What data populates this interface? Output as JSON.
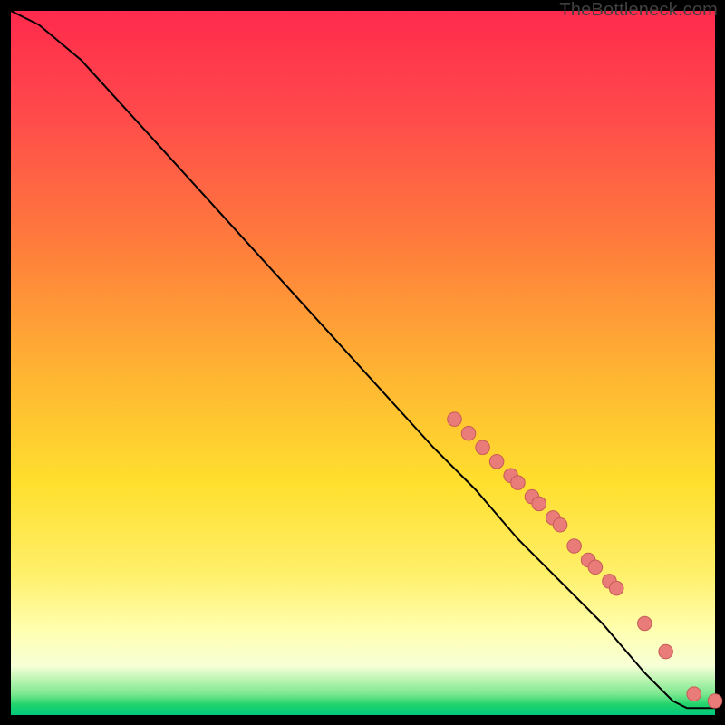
{
  "attribution": "TheBottleneck.com",
  "colors": {
    "dot_fill": "#e97c78",
    "dot_stroke": "#c65b57",
    "curve": "#000000",
    "bg": "#000000"
  },
  "chart_data": {
    "type": "line",
    "title": "",
    "xlabel": "",
    "ylabel": "",
    "xlim": [
      0,
      100
    ],
    "ylim": [
      0,
      100
    ],
    "grid": false,
    "background_gradient": [
      {
        "pos": 0,
        "color": "#ff2a4d"
      },
      {
        "pos": 33,
        "color": "#ff7c3c"
      },
      {
        "pos": 67,
        "color": "#ffdf2e"
      },
      {
        "pos": 90,
        "color": "#ffffb0"
      },
      {
        "pos": 100,
        "color": "#00c97a"
      }
    ],
    "series": [
      {
        "name": "curve",
        "kind": "line",
        "x": [
          0,
          4,
          10,
          20,
          30,
          40,
          50,
          60,
          66,
          72,
          78,
          84,
          90,
          94,
          96,
          100
        ],
        "y": [
          100,
          98,
          93,
          82,
          71,
          60,
          49,
          38,
          32,
          25,
          19,
          13,
          6,
          2,
          1,
          1
        ]
      },
      {
        "name": "markers",
        "kind": "scatter",
        "x": [
          63,
          65,
          67,
          69,
          71,
          72,
          74,
          75,
          77,
          78,
          80,
          82,
          83,
          85,
          86,
          90,
          93,
          97,
          100
        ],
        "y": [
          42,
          40,
          38,
          36,
          34,
          33,
          31,
          30,
          28,
          27,
          24,
          22,
          21,
          19,
          18,
          13,
          9,
          3,
          2
        ]
      }
    ]
  }
}
